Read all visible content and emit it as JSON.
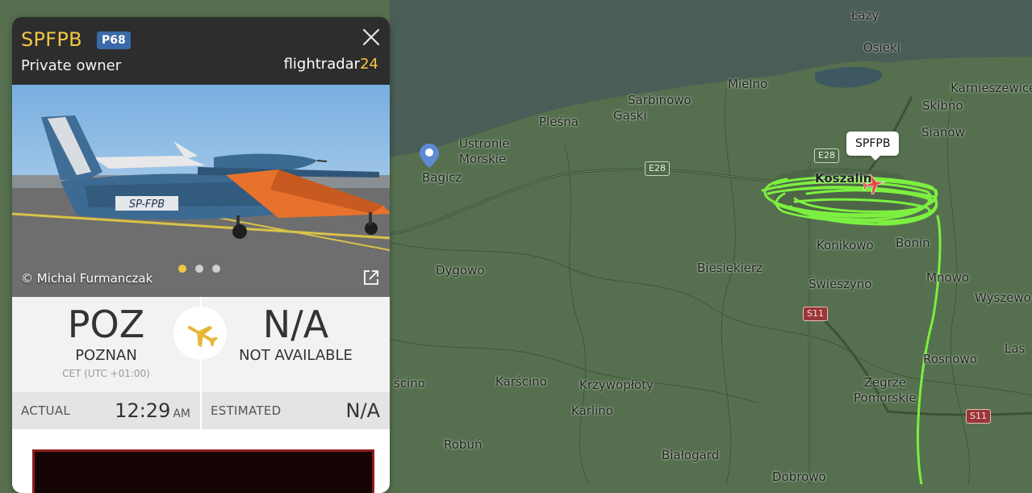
{
  "map": {
    "places": [
      {
        "id": "lazy",
        "name": "Łazy"
      },
      {
        "id": "osieki",
        "name": "Osieki"
      },
      {
        "id": "mielno",
        "name": "Mielno"
      },
      {
        "id": "karnieszewice",
        "name": "Karnieszewice"
      },
      {
        "id": "sarbinowo",
        "name": "Sarbinowo"
      },
      {
        "id": "gaski",
        "name": "Gąski"
      },
      {
        "id": "skibno",
        "name": "Skibno"
      },
      {
        "id": "plesna",
        "name": "Pleśna"
      },
      {
        "id": "sianow",
        "name": "Sianów"
      },
      {
        "id": "ustronie",
        "name": "Ustronie\nMorskie"
      },
      {
        "id": "bagicz",
        "name": "Bagicz"
      },
      {
        "id": "koszalin",
        "name": "Koszalin"
      },
      {
        "id": "konikowo",
        "name": "Konikowo"
      },
      {
        "id": "bonin",
        "name": "Bonin"
      },
      {
        "id": "dygowo",
        "name": "Dygowo"
      },
      {
        "id": "biesiekierz",
        "name": "Biesiekierz"
      },
      {
        "id": "swieszyno",
        "name": "Świeszyno"
      },
      {
        "id": "mnowo",
        "name": "Mnowo"
      },
      {
        "id": "wyszewo",
        "name": "Wyszewo"
      },
      {
        "id": "tuscino",
        "name": "ścino"
      },
      {
        "id": "karscino",
        "name": "Karścino"
      },
      {
        "id": "krzywoploty",
        "name": "Krzywopłoty"
      },
      {
        "id": "rosnowo",
        "name": "Rosnowo"
      },
      {
        "id": "zegrze",
        "name": "Zegrze\nPomorskie"
      },
      {
        "id": "karlino",
        "name": "Karlino"
      },
      {
        "id": "robun",
        "name": "Robuń"
      },
      {
        "id": "bialogard",
        "name": "Białogard"
      },
      {
        "id": "dobrowo",
        "name": "Dobrowo"
      },
      {
        "id": "lase",
        "name": "Las"
      }
    ],
    "road_badges": {
      "e28_a": "E28",
      "e28_b": "E28",
      "s11_a": "S11",
      "s11_b": "S11"
    },
    "flight_label": "SPFPB",
    "track_color": "#7cf040"
  },
  "panel": {
    "callsign": "SPFPB",
    "aircraft_type": "P68",
    "owner": "Private owner",
    "brand": {
      "name": "flightradar",
      "num": "24"
    },
    "photo_credit": "© Michal Furmanczak",
    "photo_reg": "SP-FPB",
    "photo_count": 3,
    "photo_active": 1,
    "origin": {
      "code": "POZ",
      "city": "POZNAN",
      "tz": "CET (UTC +01:00)"
    },
    "destination": {
      "code": "N/A",
      "city": "NOT AVAILABLE"
    },
    "actual": {
      "label": "ACTUAL",
      "time": "12:29",
      "ampm": "AM"
    },
    "estimated": {
      "label": "ESTIMATED",
      "value": "N/A"
    },
    "colors": {
      "accent": "#f2c644",
      "badge": "#3b6aa8",
      "header": "#2d2d2d"
    }
  }
}
